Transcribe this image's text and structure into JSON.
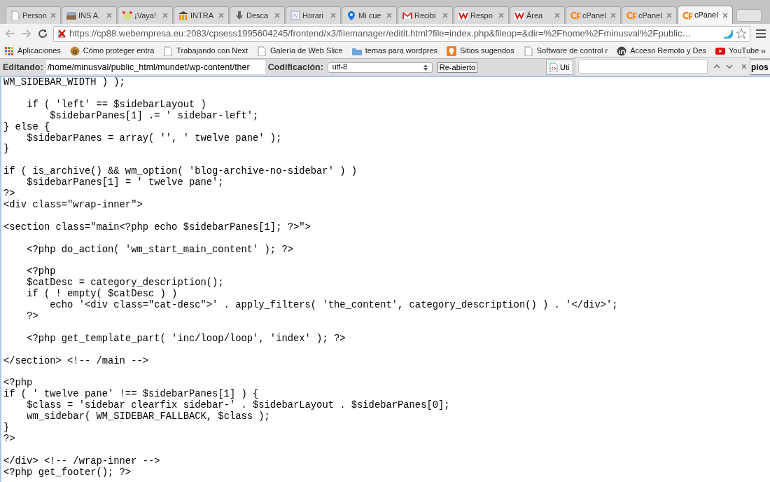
{
  "tabs": [
    {
      "label": "Person",
      "selected": false
    },
    {
      "label": "INS A.",
      "selected": false
    },
    {
      "label": "¡Vaya!",
      "selected": false
    },
    {
      "label": "INTRA",
      "selected": false
    },
    {
      "label": "Desca",
      "selected": false
    },
    {
      "label": "Horari",
      "selected": false
    },
    {
      "label": "Mi cue",
      "selected": false
    },
    {
      "label": "Recibi",
      "selected": false
    },
    {
      "label": "Respo",
      "selected": false
    },
    {
      "label": "Área",
      "selected": false
    },
    {
      "label": "cPanel",
      "selected": false
    },
    {
      "label": "cPanel",
      "selected": false
    },
    {
      "label": "cPanel",
      "selected": true
    }
  ],
  "address": {
    "url": "https://cp88.webempresa.eu:2083/cpsess1995604245/frontend/x3/filemanager/editit.html?file=index.php&fileop=&dir=%2Fhome%2Fminusval%2Fpublic…"
  },
  "bookmarks": [
    "Aplicaciones",
    "Cómo proteger entra",
    "Trabajando con Next",
    "Galería de Web Slice",
    "temas para wordpres",
    "Sitios sugeridos",
    "Software de control r",
    "Acceso Remoto y Des",
    "YouTube"
  ],
  "bookmarks_more": "»",
  "editor_bar": {
    "path_label": "Editando:",
    "path": "/home/minusval/public_html/mundet/wp-content/ther",
    "encoding_label": "Codificación:",
    "encoding": "utf-8",
    "reopen_button": "Re-abierto",
    "partial_button": "Uti",
    "save_button_partial": "pios"
  },
  "find_bar": {
    "close": "×"
  },
  "code": "WM_SIDEBAR_WIDTH ) );\n\n\tif ( 'left' == $sidebarLayout )\n\t\t$sidebarPanes[1] .= ' sidebar-left';\n} else {\n\t$sidebarPanes = array( '', ' twelve pane' );\n}\n\nif ( is_archive() && wm_option( 'blog-archive-no-sidebar' ) )\n\t$sidebarPanes[1] = ' twelve pane';\n?>\n<div class=\"wrap-inner\">\n\n<section class=\"main<?php echo $sidebarPanes[1]; ?>\">\n\n\t<?php do_action( 'wm_start_main_content' ); ?>\n\n\t<?php\n\t$catDesc = category_description();\n\tif ( ! empty( $catDesc ) )\n\t\techo '<div class=\"cat-desc\">' . apply_filters( 'the_content', category_description() ) . '</div>';\n\t?>\n\n\t<?php get_template_part( 'inc/loop/loop', 'index' ); ?>\n\n</section> <!-- /main -->\n\n<?php\nif ( ' twelve pane' !== $sidebarPanes[1] ) {\n\t$class = 'sidebar clearfix sidebar-' . $sidebarLayout . $sidebarPanes[0];\n\twm_sidebar( WM_SIDEBAR_FALLBACK, $class );\n}\n?>\n\n</div> <!-- /wrap-inner -->\n<?php get_footer(); ?>"
}
